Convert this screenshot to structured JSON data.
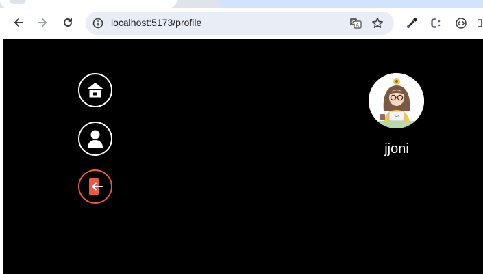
{
  "browser": {
    "url": "localhost:5173/profile",
    "icons": {
      "back": "arrow-left-icon",
      "forward": "arrow-right-icon",
      "reload": "reload-icon",
      "site_info": "info-icon",
      "translate": "translate-icon",
      "bookmark": "star-icon",
      "ext1": "eyedropper-icon",
      "ext2": "css-icon",
      "ext3": "code-icon"
    }
  },
  "sidebar_nav": {
    "items": [
      {
        "name": "home",
        "icon": "house-icon"
      },
      {
        "name": "profile",
        "icon": "user-icon"
      },
      {
        "name": "logout",
        "icon": "logout-door-icon",
        "color": "#e85a45"
      }
    ]
  },
  "profile": {
    "username": "jjoni",
    "avatar": "avatar-illustration"
  }
}
